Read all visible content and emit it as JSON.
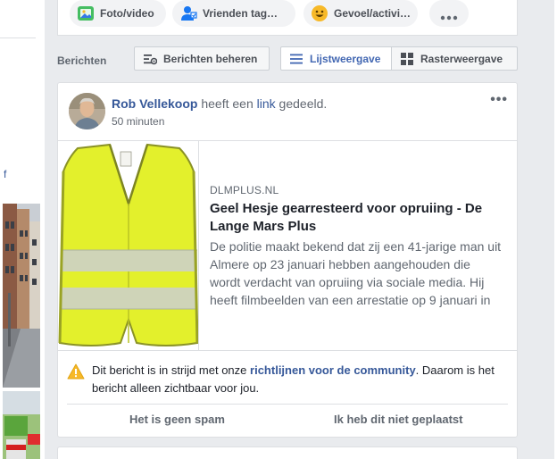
{
  "composer": {
    "options": [
      {
        "label": "Foto/video",
        "icon": "photo-video-icon"
      },
      {
        "label": "Vrienden tag…",
        "icon": "tag-friends-icon"
      },
      {
        "label": "Gevoel/activi…",
        "icon": "feeling-icon"
      }
    ],
    "more_icon": "more-horizontal-icon"
  },
  "left": {
    "letter": "f"
  },
  "berichten_bar": {
    "label": "Berichten",
    "manage_label": "Berichten beheren",
    "list_view_label": "Lijstweergave",
    "grid_view_label": "Rasterweergave"
  },
  "post": {
    "author": "Rob Vellekoop",
    "action_pre": "heeft een",
    "action_link": "link",
    "action_post": "gedeeld.",
    "time": "50 minuten",
    "more": "•••",
    "link": {
      "domain": "DLMPLUS.NL",
      "title": "Geel Hesje gearresteerd voor opruiing - De Lange Mars Plus",
      "description": "De politie maakt bekend dat zij een 41-jarige man uit Almere op 23 januari hebben aangehouden die wordt verdacht van opruiing via sociale media. Hij heeft filmbeelden van een arrestatie op 9 januari in"
    },
    "warning": {
      "pre": "Dit bericht is in strijd met onze",
      "link": "richtlijnen voor de community",
      "post": ". Daarom is het bericht alleen zichtbaar voor jou."
    },
    "actions": {
      "not_spam": "Het is geen spam",
      "not_posted": "Ik heb dit niet geplaatst"
    }
  },
  "colors": {
    "link_blue": "#365899",
    "accent_blue": "#4267b2",
    "vest_yellow": "#e3f02c",
    "warning_yellow": "#f7b928"
  }
}
